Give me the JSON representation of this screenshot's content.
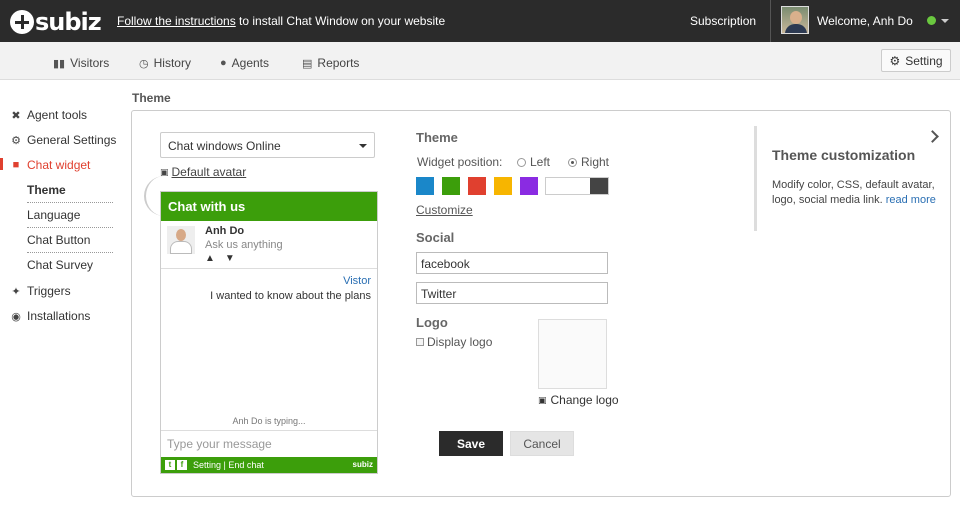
{
  "topbar": {
    "brand": "subiz",
    "notice_link": "Follow the instructions",
    "notice_rest": " to install Chat Window on your website",
    "subscription": "Subscription",
    "welcome": "Welcome, Anh Do",
    "online_color": "#6ac83f"
  },
  "nav": {
    "items": [
      {
        "label": "Visitors",
        "icon": "chat-bubbles-icon"
      },
      {
        "label": "History",
        "icon": "clock-icon"
      },
      {
        "label": "Agents",
        "icon": "user-icon"
      },
      {
        "label": "Reports",
        "icon": "report-icon"
      }
    ],
    "setting": "Setting"
  },
  "sidebar": {
    "items": [
      {
        "label": "Agent tools",
        "icon": "tools-icon"
      },
      {
        "label": "General Settings",
        "icon": "gear-icon"
      },
      {
        "label": "Chat widget",
        "icon": "chat-icon"
      },
      {
        "label": "Triggers",
        "icon": "wand-icon"
      },
      {
        "label": "Installations",
        "icon": "box-icon"
      }
    ],
    "subitems": [
      "Theme",
      "Language",
      "Chat Button",
      "Chat Survey"
    ],
    "accent_color": "#e0402f"
  },
  "main": {
    "heading": "Theme",
    "status_select": "Chat windows Online",
    "default_avatar": "Default avatar"
  },
  "widget": {
    "header": "Chat with us",
    "agent_name": "Anh Do",
    "agent_status": "Ask us anything",
    "sender": "Vistor",
    "message": "I wanted to know about the plans",
    "typing": "Anh Do is typing...",
    "input_placeholder": "Type your message",
    "footer_links": "Setting | End chat",
    "footer_brand": "subiz",
    "color": "#3c9e0b"
  },
  "theme_settings": {
    "title": "Theme",
    "position_label": "Widget position:",
    "position_left": "Left",
    "position_right": "Right",
    "selected_position": "Right",
    "colors": [
      "#1a87c9",
      "#3c9e0b",
      "#e0402f",
      "#f7b500",
      "#8a2be2",
      "#ffffff",
      "#444444"
    ],
    "customize": "Customize",
    "social_title": "Social",
    "facebook_value": "facebook",
    "twitter_value": "Twitter",
    "logo_title": "Logo",
    "display_logo": "Display logo",
    "change_logo": "Change logo",
    "save": "Save",
    "cancel": "Cancel"
  },
  "customization": {
    "title": "Theme customization",
    "desc": "Modify color, CSS, default avatar, logo, social media link.",
    "read_more": "read more"
  }
}
